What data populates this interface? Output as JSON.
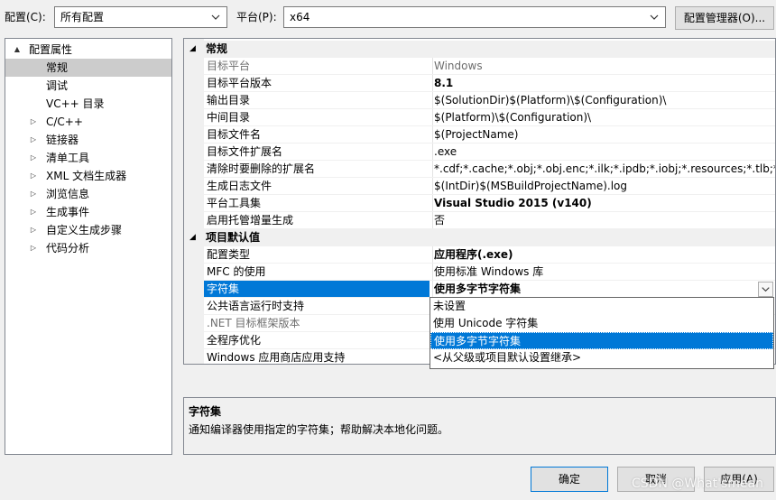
{
  "top": {
    "config_label": "配置(C):",
    "config_value": "所有配置",
    "platform_label": "平台(P):",
    "platform_value": "x64",
    "config_manager_button": "配置管理器(O)..."
  },
  "tree": [
    {
      "label": "配置属性",
      "level": 0,
      "expander": "▲"
    },
    {
      "label": "常规",
      "level": 1,
      "expander": "",
      "selected": true
    },
    {
      "label": "调试",
      "level": 1,
      "expander": ""
    },
    {
      "label": "VC++ 目录",
      "level": 1,
      "expander": ""
    },
    {
      "label": "C/C++",
      "level": 1,
      "expander": "▷"
    },
    {
      "label": "链接器",
      "level": 1,
      "expander": "▷"
    },
    {
      "label": "清单工具",
      "level": 1,
      "expander": "▷"
    },
    {
      "label": "XML 文档生成器",
      "level": 1,
      "expander": "▷"
    },
    {
      "label": "浏览信息",
      "level": 1,
      "expander": "▷"
    },
    {
      "label": "生成事件",
      "level": 1,
      "expander": "▷"
    },
    {
      "label": "自定义生成步骤",
      "level": 1,
      "expander": "▷"
    },
    {
      "label": "代码分析",
      "level": 1,
      "expander": "▷"
    }
  ],
  "grid": {
    "sections": [
      {
        "title": "常规",
        "rows": [
          {
            "key": "目标平台",
            "value": "Windows",
            "dim": true
          },
          {
            "key": "目标平台版本",
            "value": "8.1",
            "bold": true
          },
          {
            "key": "输出目录",
            "value": "$(SolutionDir)$(Platform)\\$(Configuration)\\"
          },
          {
            "key": "中间目录",
            "value": "$(Platform)\\$(Configuration)\\"
          },
          {
            "key": "目标文件名",
            "value": "$(ProjectName)"
          },
          {
            "key": "目标文件扩展名",
            "value": ".exe"
          },
          {
            "key": "清除时要删除的扩展名",
            "value": "*.cdf;*.cache;*.obj;*.obj.enc;*.ilk;*.ipdb;*.iobj;*.resources;*.tlb;*.tli;*.t"
          },
          {
            "key": "生成日志文件",
            "value": "$(IntDir)$(MSBuildProjectName).log"
          },
          {
            "key": "平台工具集",
            "value": "Visual Studio 2015 (v140)",
            "bold": true
          },
          {
            "key": "启用托管增量生成",
            "value": "否"
          }
        ]
      },
      {
        "title": "项目默认值",
        "rows": [
          {
            "key": "配置类型",
            "value": "应用程序(.exe)",
            "bold": true
          },
          {
            "key": "MFC 的使用",
            "value": "使用标准 Windows 库"
          },
          {
            "key": "字符集",
            "value": "使用多字节字符集",
            "selected": true
          },
          {
            "key": "公共语言运行时支持",
            "value": ""
          },
          {
            "key": ".NET 目标框架版本",
            "value": "",
            "dim": true
          },
          {
            "key": "全程序优化",
            "value": ""
          },
          {
            "key": "Windows 应用商店应用支持",
            "value": ""
          }
        ]
      }
    ]
  },
  "dropdown": {
    "options": [
      "未设置",
      "使用 Unicode 字符集",
      "使用多字节字符集",
      "<从父级或项目默认设置继承>"
    ],
    "selected_index": 2
  },
  "description": {
    "title": "字符集",
    "text": "通知编译器使用指定的字符集；帮助解决本地化问题。"
  },
  "buttons": {
    "ok": "确定",
    "cancel": "取消",
    "apply": "应用(A)"
  },
  "watermark": "CSDN @What'smean"
}
